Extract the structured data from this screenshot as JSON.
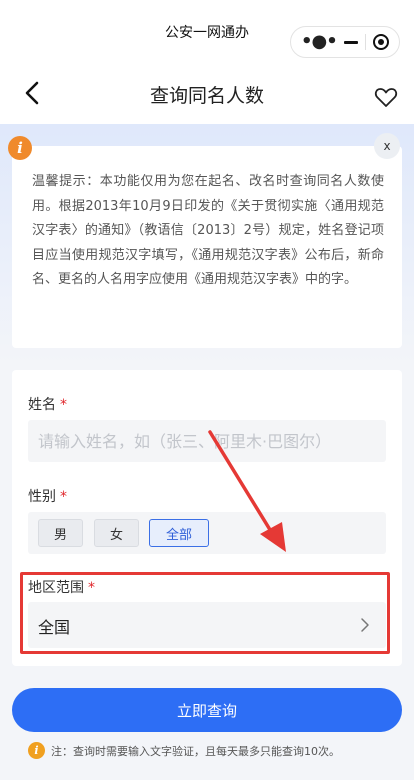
{
  "app": {
    "title": "公安一网通办"
  },
  "nav": {
    "title": "查询同名人数"
  },
  "notice": {
    "text": "温馨提示：本功能仅用为您在起名、改名时查询同名人数使用。根据2013年10月9日印发的《关于贯彻实施〈通用规范汉字表〉的通知》（教语信〔2013〕2号）规定，姓名登记项目应当使用规范汉字填写，《通用规范汉字表》公布后，新命名、更名的人名用字应使用《通用规范汉字表》中的字。",
    "close_label": "x",
    "info_glyph": "i"
  },
  "form": {
    "name": {
      "label": "姓名",
      "required": "*",
      "placeholder": "请输入姓名，如（张三、阿里木·巴图尔）",
      "value": ""
    },
    "gender": {
      "label": "性别",
      "required": "*",
      "options": [
        "男",
        "女",
        "全部"
      ],
      "selected": "全部"
    },
    "region": {
      "label": "地区范围",
      "required": "*",
      "value": "全国"
    }
  },
  "submit": {
    "label": "立即查询"
  },
  "footnote": {
    "glyph": "i",
    "text": "注：查询时需要输入文字验证，且每天最多只能查询10次。"
  },
  "colors": {
    "accent": "#2d6ef5",
    "required": "#e0262b",
    "highlight": "#e53935",
    "info": "#f08a2c"
  }
}
